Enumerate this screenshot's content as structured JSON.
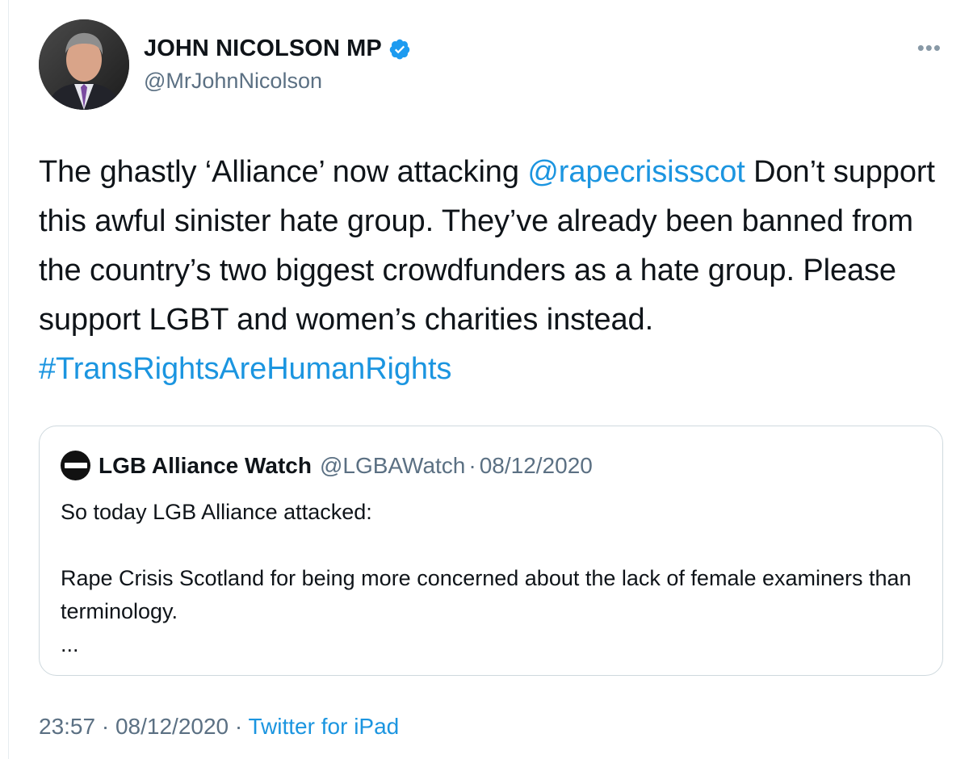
{
  "tweet": {
    "author": {
      "display_name": "JOHN NICOLSON MP",
      "handle": "@MrJohnNicolson",
      "verified": true,
      "avatar_icon": "profile-photo"
    },
    "more_icon": "more-horizontal-icon",
    "text": {
      "part1": "The ghastly ‘Alliance’  now attacking ",
      "mention": "@rapecrisisscot",
      "part2": " Don’t support this awful sinister hate group. They’ve already been banned from the country’s two biggest crowdfunders as a hate group. Please support LGBT and women’s charities instead. ",
      "hashtag": "#TransRightsAreHumanRights"
    },
    "quoted": {
      "display_name": "LGB Alliance Watch",
      "handle": "@LGBAWatch",
      "separator": "·",
      "date": "08/12/2020",
      "line1": "So today LGB Alliance attacked:",
      "line2": "Rape Crisis Scotland for being more concerned about the lack of female examiners than terminology.",
      "ellipsis": "..."
    },
    "meta": {
      "time": "23:57",
      "sep1": " · ",
      "date": "08/12/2020",
      "sep2": " · ",
      "source": "Twitter for iPad"
    },
    "colors": {
      "link": "#1b95e0",
      "secondary": "#5b7083",
      "border": "#cfd9de",
      "verified": "#1d9bf0"
    }
  }
}
